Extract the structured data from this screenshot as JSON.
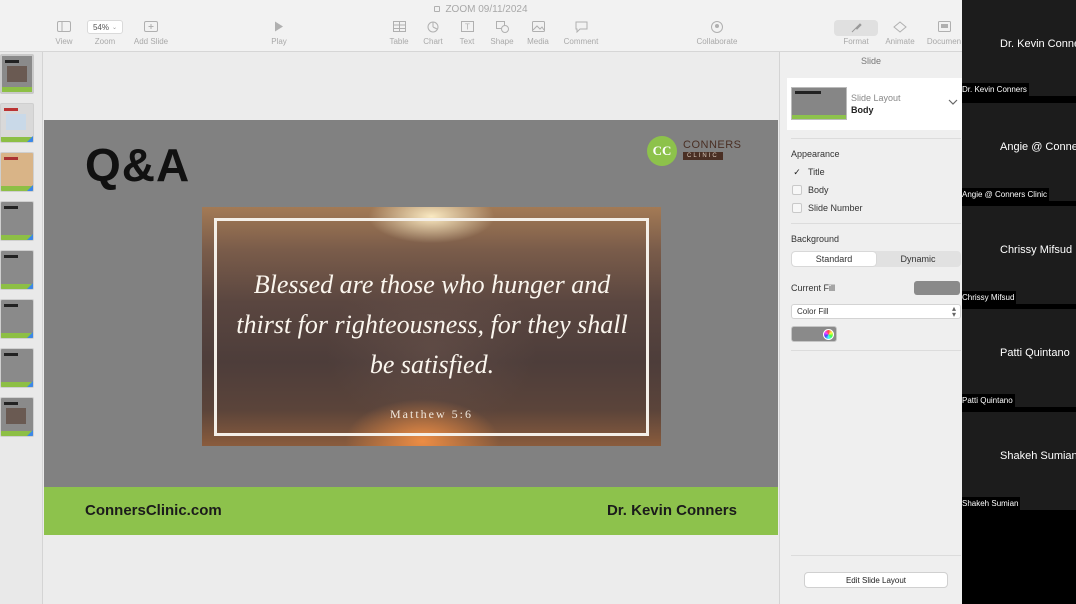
{
  "window": {
    "title": "ZOOM 09/11/2024"
  },
  "toolbar": {
    "view": "View",
    "zoom_value": "54%",
    "zoom": "Zoom",
    "add_slide": "Add Slide",
    "play": "Play",
    "table": "Table",
    "chart": "Chart",
    "text": "Text",
    "shape": "Shape",
    "media": "Media",
    "comment": "Comment",
    "collaborate": "Collaborate",
    "format": "Format",
    "animate": "Animate",
    "document": "Documen"
  },
  "slide": {
    "title": "Q&A",
    "logo_circle": "CC",
    "logo_word": "CONNERS",
    "logo_sub": "CLINIC",
    "quote_lines": [
      "Blessed are those who hunger and",
      "thirst for righteousness, for they shall",
      "be satisfied."
    ],
    "quote_ref": "Matthew 5:6",
    "footer_left": "ConnersClinic.com",
    "footer_right": "Dr. Kevin Conners",
    "band_color": "#8dc24c"
  },
  "inspector": {
    "tab": "Slide",
    "layout_caption": "Slide Layout",
    "layout_value": "Body",
    "appearance": "Appearance",
    "appearance_items": [
      {
        "label": "Title",
        "checked": true
      },
      {
        "label": "Body",
        "checked": false
      },
      {
        "label": "Slide Number",
        "checked": false
      }
    ],
    "background": "Background",
    "seg_standard": "Standard",
    "seg_dynamic": "Dynamic",
    "current_fill": "Current Fill",
    "fill_type": "Color Fill",
    "edit_layout": "Edit Slide Layout"
  },
  "participants": [
    {
      "display": "Dr. Kevin Conners",
      "tag": "Dr. Kevin Conners"
    },
    {
      "display": "Angie @ Conners Clinic",
      "tag": "Angie @ Conners Clinic"
    },
    {
      "display": "Chrissy Mifsud",
      "tag": "Chrissy Mifsud"
    },
    {
      "display": "Patti Quintano",
      "tag": "Patti Quintano"
    },
    {
      "display": "Shakeh Sumian",
      "tag": "Shakeh Sumian"
    }
  ]
}
